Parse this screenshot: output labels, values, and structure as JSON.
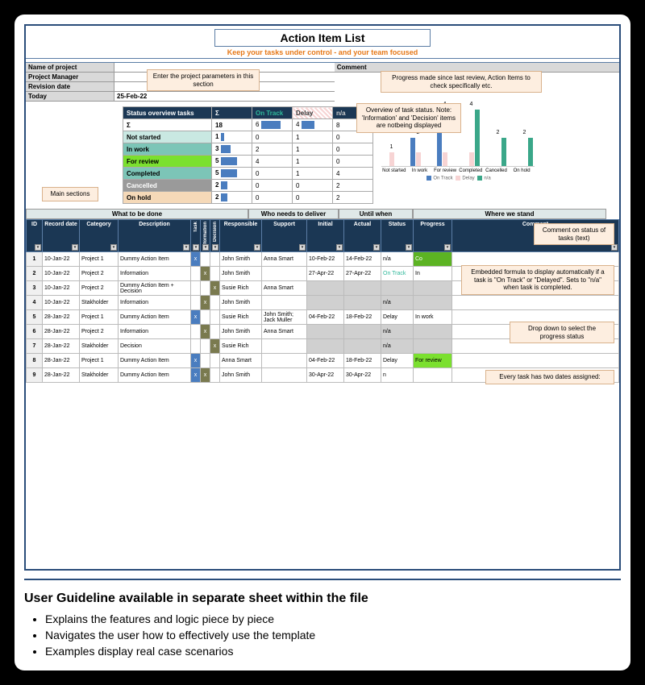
{
  "title": "Action Item List",
  "subtitle": "Keep your tasks under control - and your team focused",
  "params": {
    "name_label": "Name of project",
    "manager_label": "Project Manager",
    "revision_label": "Revision date",
    "today_label": "Today",
    "today_value": "25-Feb-22",
    "comment_label": "Comment"
  },
  "callouts": {
    "params": "Enter the project parameters in this section",
    "comment": "Progress made since last review, Action Items to check specifically etc.",
    "overview": "Overview of task status. Note: 'Information' and 'Decision' items are notbeing displayed",
    "sections": "Main sections",
    "task_comment": "Comment on status of tasks (text)",
    "formula": "Embedded formula to display automatically if a task is \"On Track\" or \"Delayed\". Sets to \"n/a\" when task is completed.",
    "dropdown": "Drop down to select the progress status",
    "dates": "Every task has two dates assigned:"
  },
  "overview": {
    "header": "Status overview tasks",
    "sigma": "Σ",
    "ontrack": "On Track",
    "delay": "Delay",
    "na": "n/a",
    "rows": [
      {
        "label": "Σ",
        "sigma": "18",
        "ontrack": "6",
        "delay": "4",
        "na": "8",
        "cls": ""
      },
      {
        "label": "Not started",
        "sigma": "1",
        "ontrack": "0",
        "delay": "1",
        "na": "0",
        "cls": "ov-notstarted"
      },
      {
        "label": "In work",
        "sigma": "3",
        "ontrack": "2",
        "delay": "1",
        "na": "0",
        "cls": "ov-inwork"
      },
      {
        "label": "For review",
        "sigma": "5",
        "ontrack": "4",
        "delay": "1",
        "na": "0",
        "cls": "ov-forreview"
      },
      {
        "label": "Completed",
        "sigma": "5",
        "ontrack": "0",
        "delay": "1",
        "na": "4",
        "cls": "ov-completed"
      },
      {
        "label": "Cancelled",
        "sigma": "2",
        "ontrack": "0",
        "delay": "0",
        "na": "2",
        "cls": "ov-cancelled"
      },
      {
        "label": "On hold",
        "sigma": "2",
        "ontrack": "0",
        "delay": "0",
        "na": "2",
        "cls": "ov-onhold"
      }
    ]
  },
  "chart_data": {
    "type": "bar",
    "categories": [
      "Not started",
      "In work",
      "For review",
      "Completed",
      "Cancelled",
      "On hold"
    ],
    "series": [
      {
        "name": "On Track",
        "values": [
          0,
          2,
          4,
          0,
          0,
          0
        ]
      },
      {
        "name": "Delay",
        "values": [
          1,
          1,
          1,
          1,
          0,
          0
        ]
      },
      {
        "name": "n/a",
        "values": [
          0,
          0,
          0,
          4,
          2,
          2
        ]
      }
    ],
    "ylim": [
      0,
      4
    ],
    "legend": [
      "On Track",
      "Delay",
      "n/a"
    ]
  },
  "groups": {
    "what": "What to be done",
    "who": "Who needs to deliver",
    "until": "Until when",
    "where": "Where we stand"
  },
  "columns": {
    "id": "ID",
    "record": "Record date",
    "category": "Category",
    "description": "Description",
    "task": "Task",
    "information": "Information",
    "decision": "Decision",
    "responsible": "Responsible",
    "support": "Support",
    "initial": "Initial",
    "actual": "Actual",
    "status": "Status",
    "progress": "Progress",
    "comment": "Comment"
  },
  "tasks": [
    {
      "id": "1",
      "date": "10-Jan-22",
      "cat": "Project 1",
      "desc": "Dummy Action Item",
      "t": "x",
      "i": "",
      "d": "",
      "resp": "John Smith",
      "sup": "Anna Smart",
      "init": "10-Feb-22",
      "act": "14-Feb-22",
      "status": "n/a",
      "prog": "Co",
      "progcls": "status-completed"
    },
    {
      "id": "2",
      "date": "10-Jan-22",
      "cat": "Project 2",
      "desc": "Information",
      "t": "",
      "i": "x",
      "d": "",
      "resp": "John Smith",
      "sup": "",
      "init": "27-Apr-22",
      "act": "27-Apr-22",
      "status": "On Track",
      "statuscls": "status-ontrack",
      "prog": "In",
      "progcls": ""
    },
    {
      "id": "3",
      "date": "10-Jan-22",
      "cat": "Project 2",
      "desc": "Dummy Action Item + Decision",
      "t": "",
      "i": "",
      "d": "x",
      "resp": "Susie Rich",
      "sup": "Anna Smart",
      "init": "",
      "act": "",
      "status": "",
      "prog": "",
      "grey": true
    },
    {
      "id": "4",
      "date": "10-Jan-22",
      "cat": "Stakholder",
      "desc": "Information",
      "t": "",
      "i": "x",
      "d": "",
      "resp": "John Smith",
      "sup": "",
      "init": "",
      "act": "",
      "status": "n/a",
      "prog": "",
      "grey": true
    },
    {
      "id": "5",
      "date": "28-Jan-22",
      "cat": "Project 1",
      "desc": "Dummy Action Item",
      "t": "x",
      "i": "",
      "d": "",
      "resp": "Susie Rich",
      "sup": "John Smith; Jack Muller",
      "init": "04-Feb-22",
      "act": "18-Feb-22",
      "status": "Delay",
      "prog": "In work",
      "progcls": ""
    },
    {
      "id": "6",
      "date": "28-Jan-22",
      "cat": "Project 2",
      "desc": "Information",
      "t": "",
      "i": "x",
      "d": "",
      "resp": "John Smith",
      "sup": "Anna Smart",
      "init": "",
      "act": "",
      "status": "n/a",
      "prog": "",
      "grey": true
    },
    {
      "id": "7",
      "date": "28-Jan-22",
      "cat": "Stakholder",
      "desc": "Decision",
      "t": "",
      "i": "",
      "d": "x",
      "resp": "Susie Rich",
      "sup": "",
      "init": "",
      "act": "",
      "status": "n/a",
      "prog": "",
      "grey": true
    },
    {
      "id": "8",
      "date": "28-Jan-22",
      "cat": "Project 1",
      "desc": "Dummy Action Item",
      "t": "x",
      "i": "",
      "d": "",
      "resp": "Anna Smart",
      "sup": "",
      "init": "04-Feb-22",
      "act": "18-Feb-22",
      "status": "Delay",
      "prog": "For review",
      "progcls": "status-forreview"
    },
    {
      "id": "9",
      "date": "28-Jan-22",
      "cat": "Stakholder",
      "desc": "Dummy Action Item",
      "t": "x",
      "i": "x",
      "d": "",
      "resp": "John Smith",
      "sup": "",
      "init": "30-Apr-22",
      "act": "30-Apr-22",
      "status": "n",
      "prog": ""
    }
  ],
  "guideline": {
    "title": "User Guideline available in separate sheet within the file",
    "items": [
      "Explains the features and logic piece by piece",
      "Navigates the user how to effectively use the template",
      "Examples display real case scenarios"
    ]
  }
}
